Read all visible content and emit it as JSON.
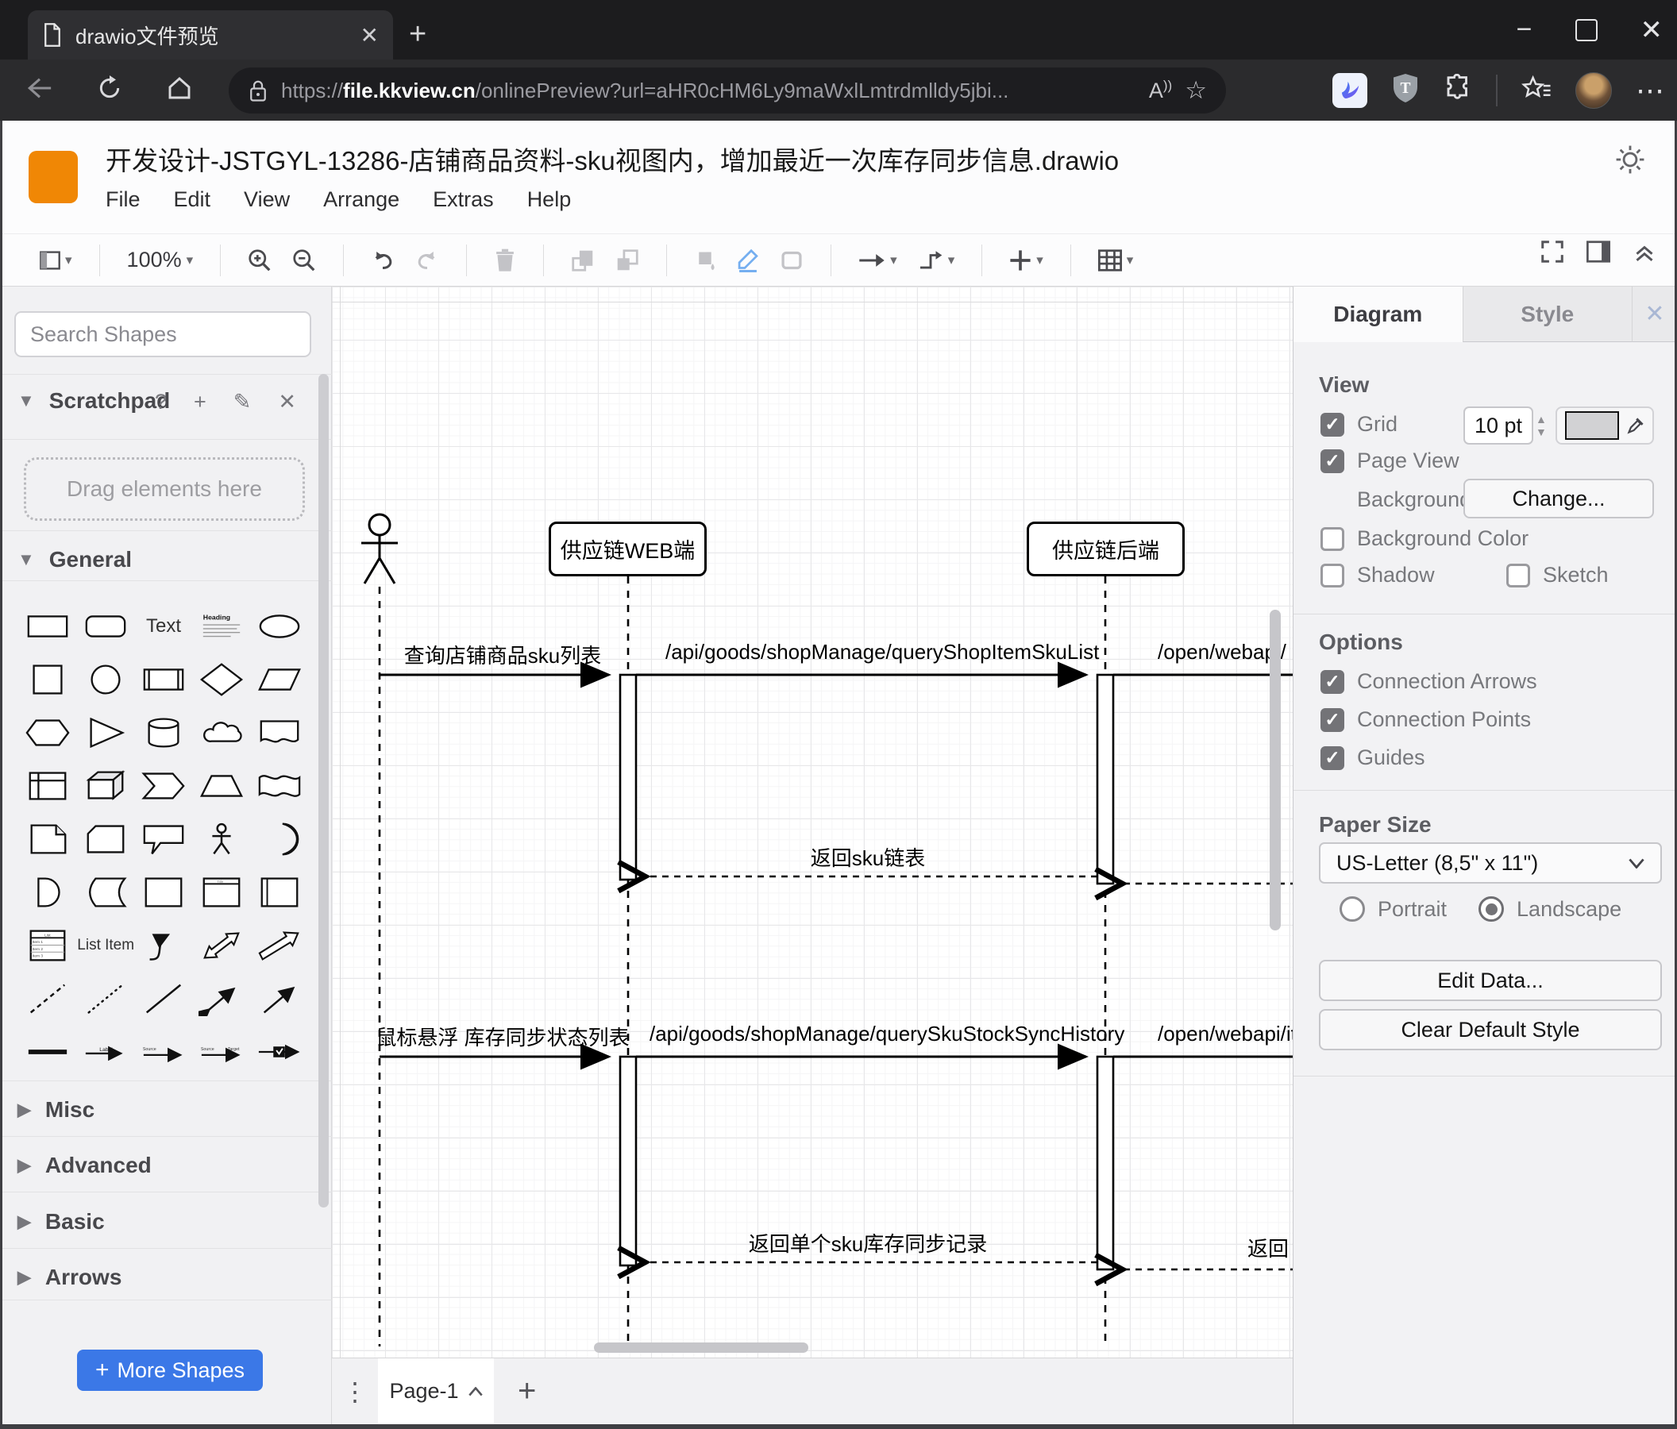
{
  "browser": {
    "tab_title": "drawio文件预览",
    "url_scheme": "https://",
    "url_host": "file.kkview.cn",
    "url_path": "/onlinePreview?url=aHR0cHM6Ly9maWxlLmtrdmlldy5jbi...",
    "read_aloud": "A"
  },
  "app": {
    "title": "开发设计-JSTGYL-13286-店铺商品资料-sku视图内，增加最近一次库存同步信息.drawio",
    "menus": [
      "File",
      "Edit",
      "View",
      "Arrange",
      "Extras",
      "Help"
    ],
    "zoom_level": "100%"
  },
  "sidebar": {
    "search_placeholder": "Search Shapes",
    "scratchpad_title": "Scratchpad",
    "drag_hint": "Drag elements here",
    "general_title": "General",
    "sections": [
      "Misc",
      "Advanced",
      "Basic",
      "Arrows"
    ],
    "more_shapes": "More Shapes",
    "shapes": [
      {
        "name": "rectangle",
        "icon": "rect"
      },
      {
        "name": "rounded-rectangle",
        "icon": "rrect"
      },
      {
        "name": "text",
        "text": "Text"
      },
      {
        "name": "heading",
        "icon": "heading"
      },
      {
        "name": "ellipse",
        "icon": "ellipse"
      },
      {
        "name": "square",
        "icon": "square"
      },
      {
        "name": "circle",
        "icon": "circle"
      },
      {
        "name": "process",
        "icon": "process"
      },
      {
        "name": "diamond",
        "icon": "diamond"
      },
      {
        "name": "parallelogram",
        "icon": "parallelogram"
      },
      {
        "name": "hexagon",
        "icon": "hexagon"
      },
      {
        "name": "triangle",
        "icon": "triangle"
      },
      {
        "name": "cylinder",
        "icon": "cylinder"
      },
      {
        "name": "cloud",
        "icon": "cloud"
      },
      {
        "name": "document",
        "icon": "document"
      },
      {
        "name": "internal-storage",
        "icon": "internal"
      },
      {
        "name": "cube",
        "icon": "cube"
      },
      {
        "name": "step",
        "icon": "step"
      },
      {
        "name": "trapezoid",
        "icon": "trapezoid"
      },
      {
        "name": "tape",
        "icon": "tape"
      },
      {
        "name": "note",
        "icon": "note"
      },
      {
        "name": "card",
        "icon": "card"
      },
      {
        "name": "callout",
        "icon": "callout"
      },
      {
        "name": "actor",
        "icon": "actor"
      },
      {
        "name": "or",
        "icon": "or"
      },
      {
        "name": "and",
        "icon": "and"
      },
      {
        "name": "data-storage",
        "icon": "datastore"
      },
      {
        "name": "container",
        "icon": "container"
      },
      {
        "name": "titled-container",
        "icon": "containertitle"
      },
      {
        "name": "vertical-container",
        "icon": "vcontainer"
      },
      {
        "name": "list",
        "icon": "list"
      },
      {
        "name": "list-item",
        "text": "List Item",
        "small": true
      },
      {
        "name": "curve",
        "icon": "curve"
      },
      {
        "name": "bidirectional-block-arrow",
        "icon": "bidirblock"
      },
      {
        "name": "block-arrow",
        "icon": "blockarrow"
      },
      {
        "name": "dashed-line",
        "icon": "dashline"
      },
      {
        "name": "dotted-line",
        "icon": "dotline"
      },
      {
        "name": "line",
        "icon": "line"
      },
      {
        "name": "bidirectional-arrow",
        "icon": "bidirarrow"
      },
      {
        "name": "arrow",
        "icon": "arrow"
      },
      {
        "name": "bold-line",
        "icon": "boldline"
      },
      {
        "name": "label-arrow",
        "icon": "labelarrow"
      },
      {
        "name": "labeled-edge",
        "icon": "labelededge"
      },
      {
        "name": "labeled-edge-2",
        "icon": "labelededge2"
      },
      {
        "name": "symbol-edge",
        "icon": "symboledge"
      }
    ]
  },
  "diagram": {
    "participants": {
      "web": "供应链WEB端",
      "backend": "供应链后端"
    },
    "messages": [
      {
        "label": "查询店铺商品sku列表"
      },
      {
        "label": "/api/goods/shopManage/queryShopItemSkuList"
      },
      {
        "label": "/open/webapi/"
      },
      {
        "label": "返回sku链表"
      },
      {
        "label": "鼠标悬浮 库存同步状态列表"
      },
      {
        "label": "/api/goods/shopManage/querySkuStockSyncHistory"
      },
      {
        "label": "/open/webapi/item"
      },
      {
        "label": "返回单个sku库存同步记录"
      },
      {
        "label": "返回"
      }
    ]
  },
  "panel": {
    "tabs": [
      "Diagram",
      "Style"
    ],
    "view": {
      "header": "View",
      "grid": "Grid",
      "grid_size": "10 pt",
      "page_view": "Page View",
      "background": "Background",
      "change": "Change...",
      "background_color": "Background Color",
      "shadow": "Shadow",
      "sketch": "Sketch"
    },
    "options": {
      "header": "Options",
      "items": [
        "Connection Arrows",
        "Connection Points",
        "Guides"
      ]
    },
    "paper": {
      "header": "Paper Size",
      "size": "US-Letter (8,5\" x 11\")",
      "portrait": "Portrait",
      "landscape": "Landscape"
    },
    "buttons": [
      "Edit Data...",
      "Clear Default Style"
    ]
  },
  "footer": {
    "page_tab": "Page-1"
  },
  "colors": {
    "accent_blue": "#3b78e7",
    "logo_orange": "#f08705"
  }
}
